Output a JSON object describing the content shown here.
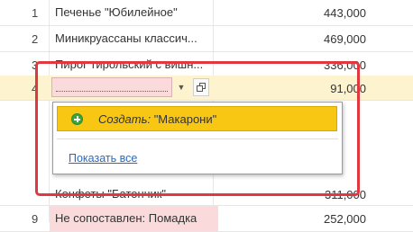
{
  "rows": [
    {
      "num": "1",
      "name": "Печенье \"Юбилейное\"",
      "sum": "443,000"
    },
    {
      "num": "2",
      "name": "Миникруассаны классич...",
      "sum": "469,000"
    },
    {
      "num": "3",
      "name": "Пирог тирольский с вишн...",
      "sum": "336,000"
    },
    {
      "num": "4",
      "name": "",
      "sum": "91,000"
    },
    {
      "num": "",
      "name": "Конфеты \"Батончик\"",
      "sum": "311,000"
    },
    {
      "num": "9",
      "name": "Не сопоставлен: Помадка",
      "sum": "252,000"
    }
  ],
  "dropdown": {
    "create_prefix": "Создать:",
    "create_value": "\"Макарони\"",
    "show_all": "Показать все"
  },
  "colors": {
    "accent_yellow": "#f7c714",
    "highlight_row": "#fdf3cf",
    "error_pink": "#fadada",
    "focus_red": "#e0383e",
    "link_blue": "#2a6ac0"
  }
}
